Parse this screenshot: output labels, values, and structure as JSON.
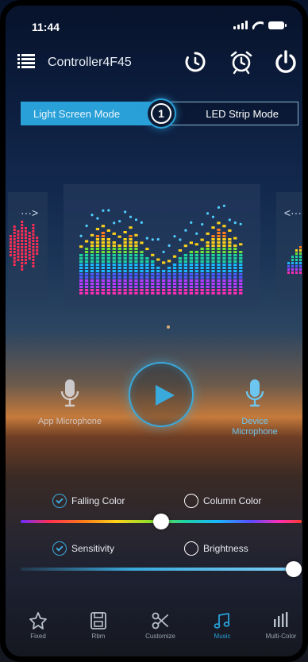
{
  "status_bar": {
    "time": "11:44"
  },
  "header": {
    "device_name": "Controller4F45"
  },
  "mode_switch": {
    "left_label": "Light Screen Mode",
    "right_label": "LED Strip Mode",
    "toggle_label": "1",
    "active": "Light Screen Mode"
  },
  "carousel": {
    "prev_label": "···>",
    "next_label": "<···"
  },
  "microphones": {
    "app_label": "App Microphone",
    "device_label": "Device Microphone",
    "selected": "Device Microphone"
  },
  "options": {
    "falling_color": {
      "label": "Falling Color",
      "checked": true
    },
    "column_color": {
      "label": "Column Color",
      "checked": false
    },
    "sensitivity": {
      "label": "Sensitivity",
      "checked": true
    },
    "brightness": {
      "label": "Brightness",
      "checked": false
    }
  },
  "sliders": {
    "color_position": 0.5,
    "sensitivity_level": 1.0
  },
  "tabs": [
    {
      "label": "Fixed",
      "icon": "star-icon"
    },
    {
      "label": "Rbm",
      "icon": "save-icon"
    },
    {
      "label": "Customize",
      "icon": "scissors-icon"
    },
    {
      "label": "Music",
      "icon": "music-note-icon",
      "active": true
    },
    {
      "label": "Multi-Color",
      "icon": "bars-icon"
    }
  ],
  "colors": {
    "accent": "#2aa0d8"
  }
}
